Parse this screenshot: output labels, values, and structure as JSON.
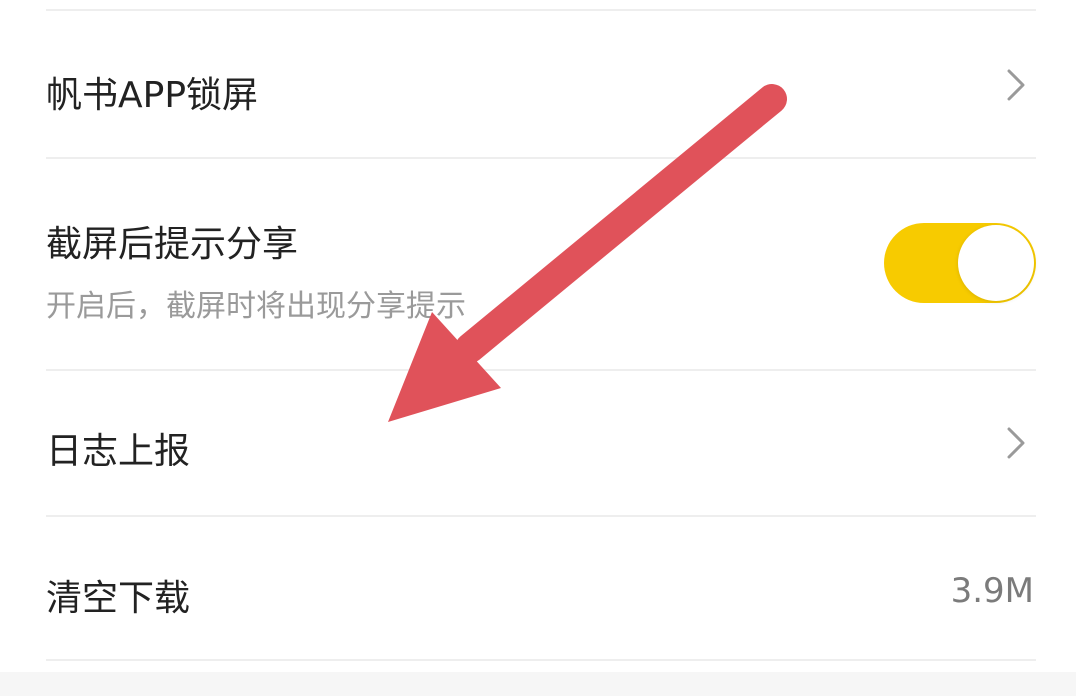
{
  "settings": {
    "lock_screen": {
      "label": "帆书APP锁屏",
      "icon": "chevron-right-icon"
    },
    "screenshot_share": {
      "label": "截屏后提示分享",
      "description": "开启后，截屏时将出现分享提示",
      "enabled": true
    },
    "log_report": {
      "label": "日志上报",
      "icon": "chevron-right-icon"
    },
    "clear_downloads": {
      "label": "清空下载",
      "value": "3.9M"
    }
  },
  "colors": {
    "toggle_on": "#f7cb00",
    "arrow": "#e0525a"
  }
}
